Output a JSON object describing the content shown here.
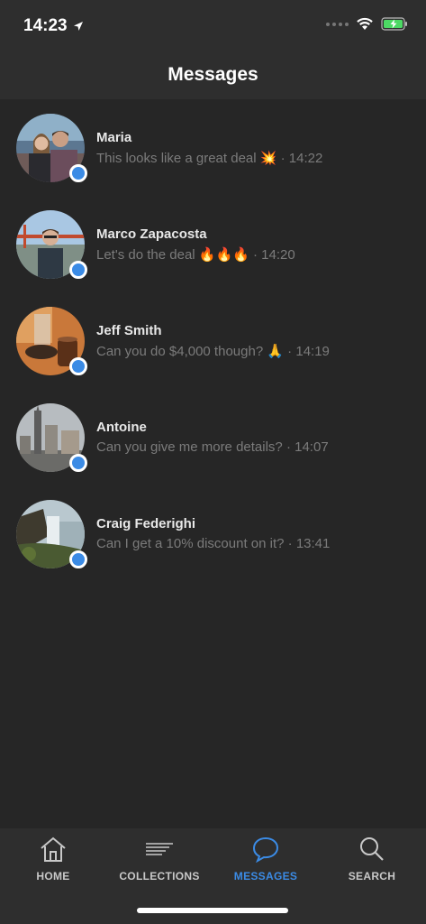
{
  "status": {
    "time": "14:23"
  },
  "header": {
    "title": "Messages"
  },
  "conversations": [
    {
      "name": "Maria",
      "message": "This looks like a great deal 💥",
      "time": "14:22"
    },
    {
      "name": "Marco Zapacosta",
      "message": "Let's do the deal 🔥🔥🔥",
      "time": "14:20"
    },
    {
      "name": "Jeff Smith",
      "message": "Can you do $4,000 though? 🙏",
      "time": "14:19"
    },
    {
      "name": "Antoine",
      "message": "Can you give me more details?",
      "time": "14:07"
    },
    {
      "name": "Craig Federighi",
      "message": "Can I get a 10% discount on it?",
      "time": "13:41"
    }
  ],
  "tabs": [
    {
      "label": "HOME",
      "icon": "home-icon"
    },
    {
      "label": "COLLECTIONS",
      "icon": "collections-icon"
    },
    {
      "label": "MESSAGES",
      "icon": "chat-bubble-icon",
      "active": true
    },
    {
      "label": "SEARCH",
      "icon": "search-icon"
    }
  ],
  "colors": {
    "accent": "#3b8be5",
    "background": "#262626",
    "bar": "#2e2e2e"
  }
}
